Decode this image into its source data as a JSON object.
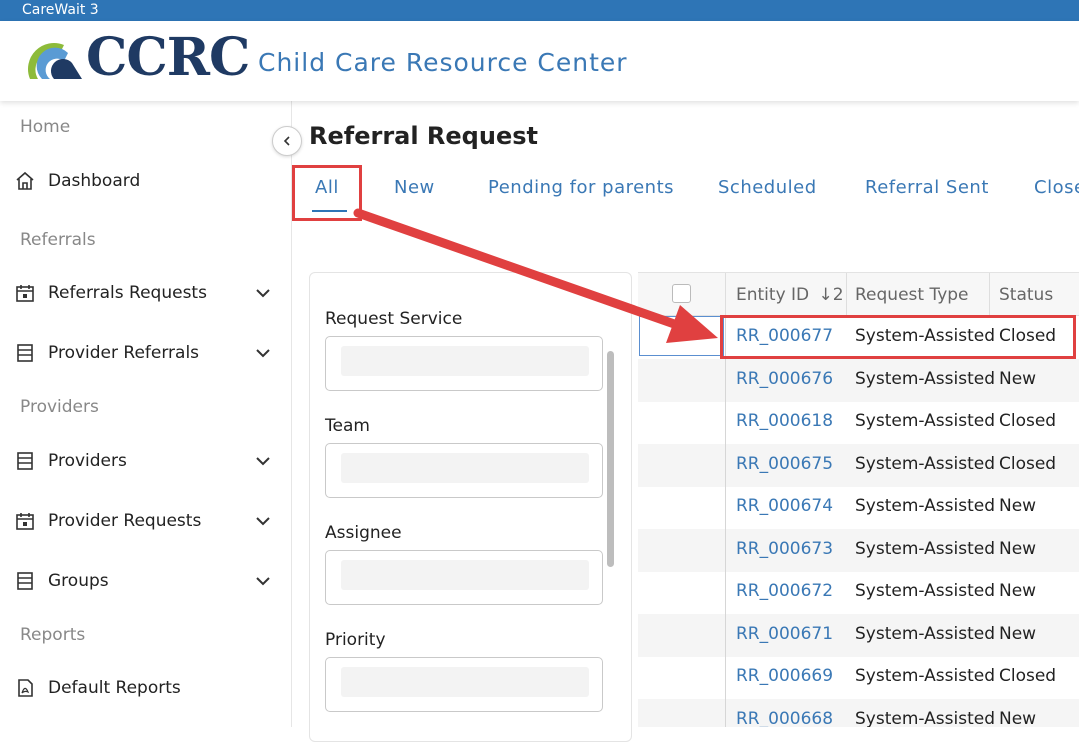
{
  "window": {
    "title": "CareWait 3"
  },
  "brand": {
    "logo_text": "CCRC",
    "subtitle": "Child Care Resource Center"
  },
  "sidebar": {
    "sections": [
      {
        "label": "Home"
      },
      {
        "label": "Referrals"
      },
      {
        "label": "Providers"
      },
      {
        "label": "Reports"
      }
    ],
    "items": [
      {
        "label": "Dashboard",
        "icon": "home-icon"
      },
      {
        "label": "Referrals Requests",
        "icon": "calendar-icon"
      },
      {
        "label": "Provider Referrals",
        "icon": "list-icon"
      },
      {
        "label": "Providers",
        "icon": "list-icon"
      },
      {
        "label": "Provider Requests",
        "icon": "calendar-icon"
      },
      {
        "label": "Groups",
        "icon": "list-icon"
      },
      {
        "label": "Default Reports",
        "icon": "pdf-icon"
      }
    ]
  },
  "page": {
    "title": "Referral Request"
  },
  "tabs": [
    {
      "label": "All",
      "active": true
    },
    {
      "label": "New"
    },
    {
      "label": "Pending for parents"
    },
    {
      "label": "Scheduled"
    },
    {
      "label": "Referral Sent"
    },
    {
      "label": "Close"
    }
  ],
  "filters": [
    {
      "label": "Request Service"
    },
    {
      "label": "Team"
    },
    {
      "label": "Assignee"
    },
    {
      "label": "Priority"
    }
  ],
  "table": {
    "columns": [
      {
        "label": "Entity ID",
        "sort": "↓2"
      },
      {
        "label": "Request Type"
      },
      {
        "label": "Status"
      }
    ],
    "rows": [
      {
        "id": "RR_000677",
        "type": "System-Assisted",
        "status": "Closed"
      },
      {
        "id": "RR_000676",
        "type": "System-Assisted",
        "status": "New"
      },
      {
        "id": "RR_000618",
        "type": "System-Assisted",
        "status": "Closed"
      },
      {
        "id": "RR_000675",
        "type": "System-Assisted",
        "status": "Closed"
      },
      {
        "id": "RR_000674",
        "type": "System-Assisted",
        "status": "New"
      },
      {
        "id": "RR_000673",
        "type": "System-Assisted",
        "status": "New"
      },
      {
        "id": "RR_000672",
        "type": "System-Assisted",
        "status": "New"
      },
      {
        "id": "RR_000671",
        "type": "System-Assisted",
        "status": "New"
      },
      {
        "id": "RR_000669",
        "type": "System-Assisted",
        "status": "Closed"
      },
      {
        "id": "RR_000668",
        "type": "System-Assisted",
        "status": "New"
      }
    ]
  },
  "colors": {
    "brand_blue": "#2e75b6",
    "link_blue": "#3a78b5",
    "annotation_red": "#e04040",
    "logo_navy": "#1f3a63"
  }
}
